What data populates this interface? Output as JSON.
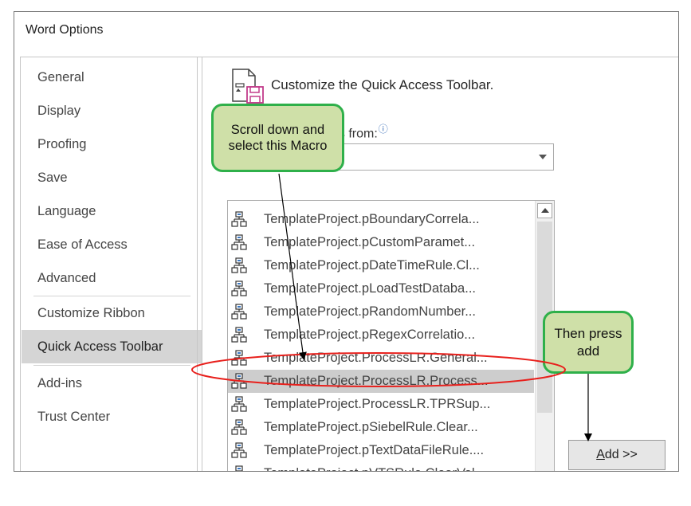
{
  "window": {
    "title": "Word Options"
  },
  "sidebar": {
    "items": [
      {
        "label": "General"
      },
      {
        "label": "Display"
      },
      {
        "label": "Proofing"
      },
      {
        "label": "Save"
      },
      {
        "label": "Language"
      },
      {
        "label": "Ease of Access"
      },
      {
        "label": "Advanced"
      },
      {
        "label": "Customize Ribbon"
      },
      {
        "label": "Quick Access Toolbar",
        "selected": true
      },
      {
        "label": "Add-ins"
      },
      {
        "label": "Trust Center"
      }
    ]
  },
  "main": {
    "heading": "Customize the Quick Access Toolbar.",
    "choose_label_visible": "ds from:",
    "info_icon": "info-icon",
    "dropdown_value": "",
    "commands": [
      {
        "label": "TemplateProject.pBoundaryCorrela..."
      },
      {
        "label": "TemplateProject.pCustomParamet..."
      },
      {
        "label": "TemplateProject.pDateTimeRule.Cl..."
      },
      {
        "label": "TemplateProject.pLoadTestDataba..."
      },
      {
        "label": "TemplateProject.pRandomNumber..."
      },
      {
        "label": "TemplateProject.pRegexCorrelatio..."
      },
      {
        "label": "TemplateProject.ProcessLR.General..."
      },
      {
        "label": "TemplateProject.ProcessLR.Process...",
        "selected": true
      },
      {
        "label": "TemplateProject.ProcessLR.TPRSup..."
      },
      {
        "label": "TemplateProject.pSiebelRule.Clear..."
      },
      {
        "label": "TemplateProject.pTextDataFileRule...."
      },
      {
        "label": "TemplateProject.pVTSRule.ClearVal..."
      }
    ],
    "add_button": {
      "accel": "A",
      "rest": "dd >>"
    }
  },
  "annotations": {
    "callout_scroll": "Scroll down and select this Macro",
    "callout_add": "Then press add",
    "callout_fill": "#cfe0a8",
    "callout_border": "#2fb04a",
    "highlight_color": "#e8201c"
  }
}
